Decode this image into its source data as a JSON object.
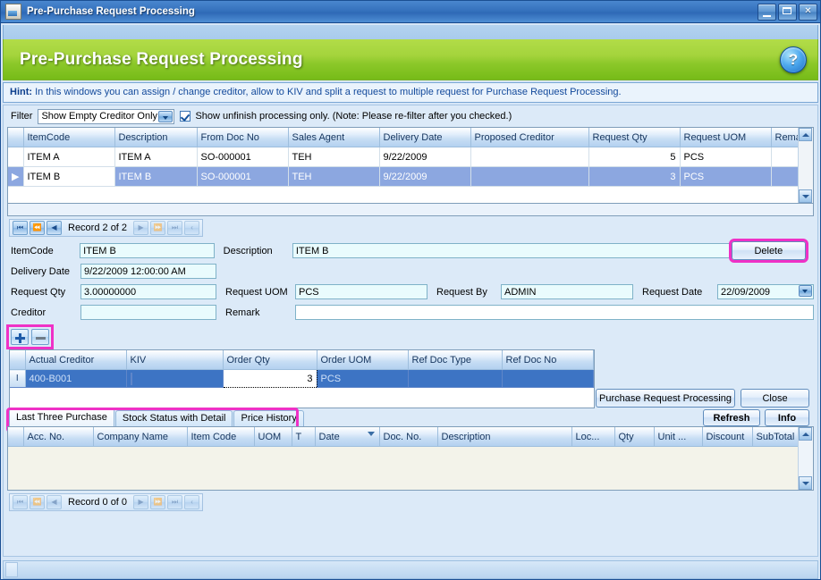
{
  "window": {
    "title": "Pre-Purchase Request Processing",
    "icon": "document-icon",
    "minimize": "_",
    "maximize": "□",
    "close": "✕"
  },
  "banner": {
    "title": "Pre-Purchase Request Processing",
    "help": "?"
  },
  "hint": {
    "label": "Hint:",
    "text": "In this windows you can assign / change creditor, allow to KIV and split a request to multiple request for Purchase Request Processing."
  },
  "filter": {
    "label": "Filter",
    "selected": "Show Empty Creditor Only",
    "options": [
      "Show Empty Creditor Only"
    ],
    "checkbox_label": "Show unfinish processing only. (Note: Please re-filter after you checked.)",
    "checkbox_checked": true
  },
  "main_grid": {
    "columns": [
      "ItemCode",
      "Description",
      "From Doc No",
      "Sales Agent",
      "Delivery Date",
      "Proposed Creditor",
      "Request Qty",
      "Request UOM",
      "Remark"
    ],
    "rows": [
      {
        "marker": "",
        "selected": false,
        "cells": [
          "ITEM A",
          "ITEM A",
          "SO-000001",
          "TEH",
          "9/22/2009",
          "",
          "5",
          "PCS",
          ""
        ]
      },
      {
        "marker": "▶",
        "selected": true,
        "cells": [
          "ITEM B",
          "ITEM B",
          "SO-000001",
          "TEH",
          "9/22/2009",
          "",
          "3",
          "PCS",
          ""
        ]
      }
    ]
  },
  "record_nav_top": {
    "first": "|◀◀",
    "prev_page": "◀◀",
    "prev": "◀",
    "label": "Record 2 of 2",
    "next": "▶",
    "next_page": "▶▶",
    "last": "▶▶|",
    "extra": "<"
  },
  "detail": {
    "itemcode_label": "ItemCode",
    "itemcode_value": "ITEM B",
    "description_label": "Description",
    "description_value": "ITEM B",
    "delivery_date_label": "Delivery Date",
    "delivery_date_value": "9/22/2009 12:00:00 AM",
    "request_qty_label": "Request Qty",
    "request_qty_value": "3.00000000",
    "request_uom_label": "Request UOM",
    "request_uom_value": "PCS",
    "request_by_label": "Request By",
    "request_by_value": "ADMIN",
    "request_date_label": "Request Date",
    "request_date_value": "22/09/2009",
    "creditor_label": "Creditor",
    "creditor_value": "",
    "remark_label": "Remark",
    "remark_value": "",
    "delete_button": "Delete"
  },
  "creditor_toolbar": {
    "add": "+",
    "remove": "−"
  },
  "creditor_grid": {
    "columns": [
      "Actual Creditor",
      "KIV",
      "Order Qty",
      "Order UOM",
      "Ref Doc Type",
      "Ref Doc No"
    ],
    "rows": [
      {
        "marker": "I",
        "selected": true,
        "actual_creditor": "400-B001",
        "kiv": false,
        "order_qty": "3",
        "order_uom": "PCS",
        "ref_doc_type": "",
        "ref_doc_no": ""
      }
    ]
  },
  "action_buttons": {
    "purchase_request_processing": "Purchase Request Processing",
    "close": "Close",
    "refresh": "Refresh",
    "info": "Info"
  },
  "tabs": [
    {
      "label": "Last Three Purchase",
      "active": true
    },
    {
      "label": "Stock Status with Detail",
      "active": false
    },
    {
      "label": "Price History",
      "active": false
    }
  ],
  "bottom_grid": {
    "columns": [
      "Acc. No.",
      "Company Name",
      "Item Code",
      "UOM",
      "T",
      "Date",
      "Doc. No.",
      "Description",
      "Loc...",
      "Qty",
      "Unit ...",
      "Discount",
      "SubTotal"
    ],
    "sorted_column": "Date",
    "rows": []
  },
  "record_nav_bottom": {
    "first": "|◀◀",
    "prev_page": "◀◀",
    "prev": "◀",
    "label": "Record 0 of 0",
    "next": "▶",
    "next_page": "▶▶",
    "last": "▶▶|",
    "extra": "<"
  },
  "colors": {
    "accent_green": "#8cc82a",
    "title_blue": "#3572bd",
    "selection_blue": "#8ca7e0",
    "grid_selection": "#3d74c4",
    "highlight_magenta": "#ef31c6",
    "field_cyan": "#e9fbfd"
  }
}
